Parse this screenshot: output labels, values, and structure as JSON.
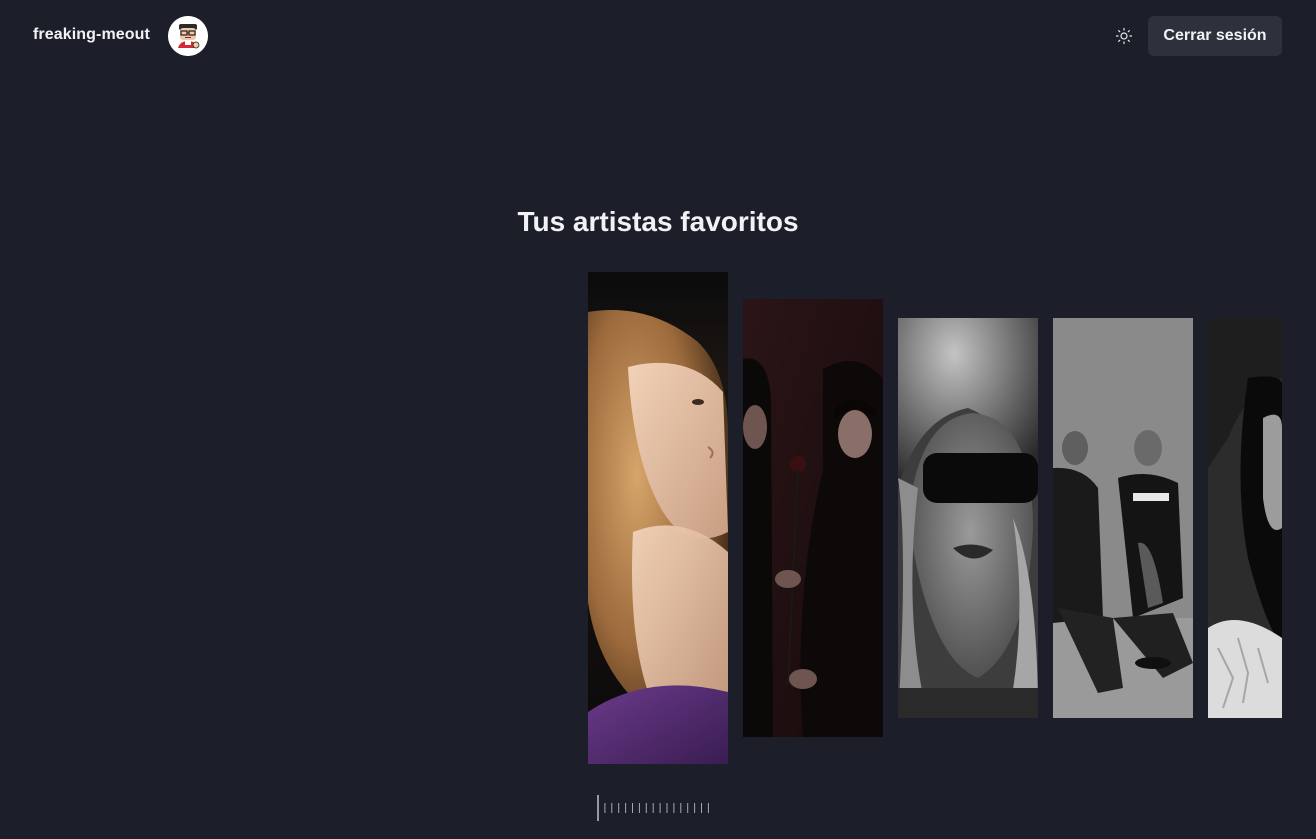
{
  "header": {
    "username": "freaking-meout",
    "avatar_icon": "cartoon-avatar-icon",
    "theme_icon": "sun-icon",
    "logout_label": "Cerrar sesión"
  },
  "main": {
    "title": "Tus artistas favoritos"
  },
  "artists": [
    {
      "icon": "artist-photo-woman-blonde-curls",
      "tone": "color-warm",
      "active": true
    },
    {
      "icon": "artist-photo-duo-with-rose",
      "tone": "dark-red"
    },
    {
      "icon": "artist-photo-woman-sunglasses",
      "tone": "grayscale"
    },
    {
      "icon": "artist-photo-band-seated",
      "tone": "grayscale"
    },
    {
      "icon": "artist-photo-woman-dark-hair",
      "tone": "grayscale"
    }
  ],
  "scrubber": {
    "tick_count": 17,
    "active_index": 0
  },
  "colors": {
    "background": "#1c1f2a",
    "button_bg": "#2d313c",
    "text": "#f1f2f5"
  }
}
